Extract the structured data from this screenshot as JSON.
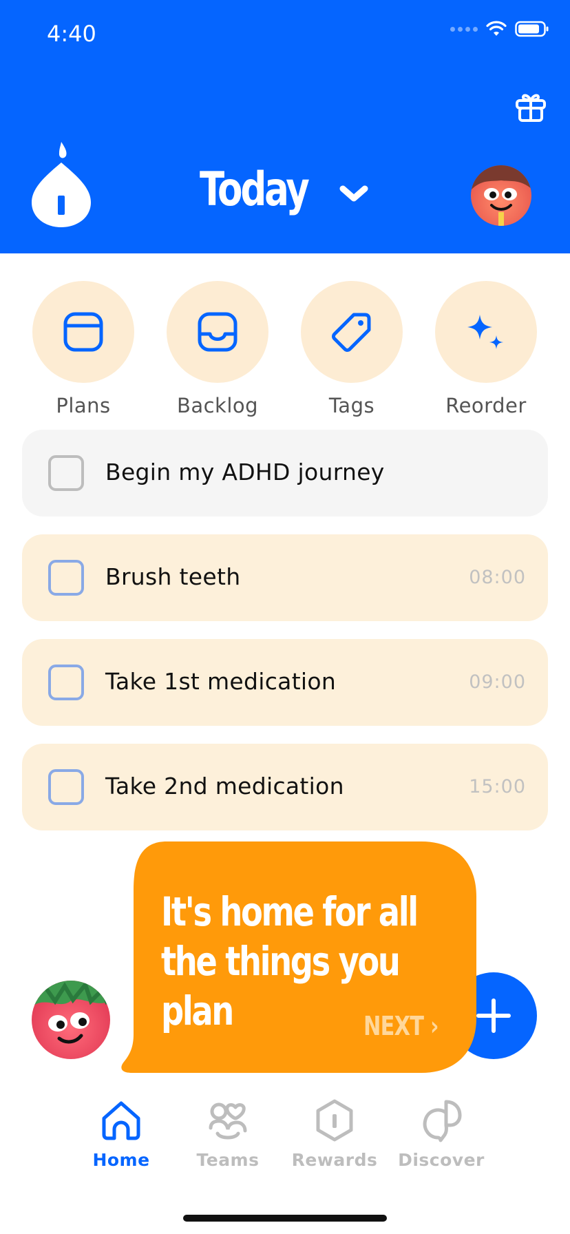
{
  "status": {
    "time": "4:40"
  },
  "header": {
    "title": "Today"
  },
  "quick_actions": [
    {
      "label": "Plans",
      "icon": "calendar-icon"
    },
    {
      "label": "Backlog",
      "icon": "inbox-icon"
    },
    {
      "label": "Tags",
      "icon": "tag-icon"
    },
    {
      "label": "Reorder",
      "icon": "sparkle-icon"
    }
  ],
  "tasks": [
    {
      "title": "Begin my ADHD journey",
      "time": ""
    },
    {
      "title": "Brush teeth",
      "time": "08:00"
    },
    {
      "title": "Take 1st medication",
      "time": "09:00"
    },
    {
      "title": "Take 2nd medication",
      "time": "15:00"
    }
  ],
  "tooltip": {
    "lines": [
      "It's home for all",
      "the things you",
      "plan"
    ],
    "next_label": "NEXT ›"
  },
  "tabs": [
    {
      "label": "Home",
      "icon": "home-icon",
      "active": true
    },
    {
      "label": "Teams",
      "icon": "teams-icon",
      "active": false
    },
    {
      "label": "Rewards",
      "icon": "rewards-icon",
      "active": false
    },
    {
      "label": "Discover",
      "icon": "discover-icon",
      "active": false
    }
  ],
  "colors": {
    "brand_blue": "#0565FF",
    "accent_orange": "#FF9A0A",
    "cream": "#FDECD3",
    "inactive_gray": "#BDBDBD"
  }
}
